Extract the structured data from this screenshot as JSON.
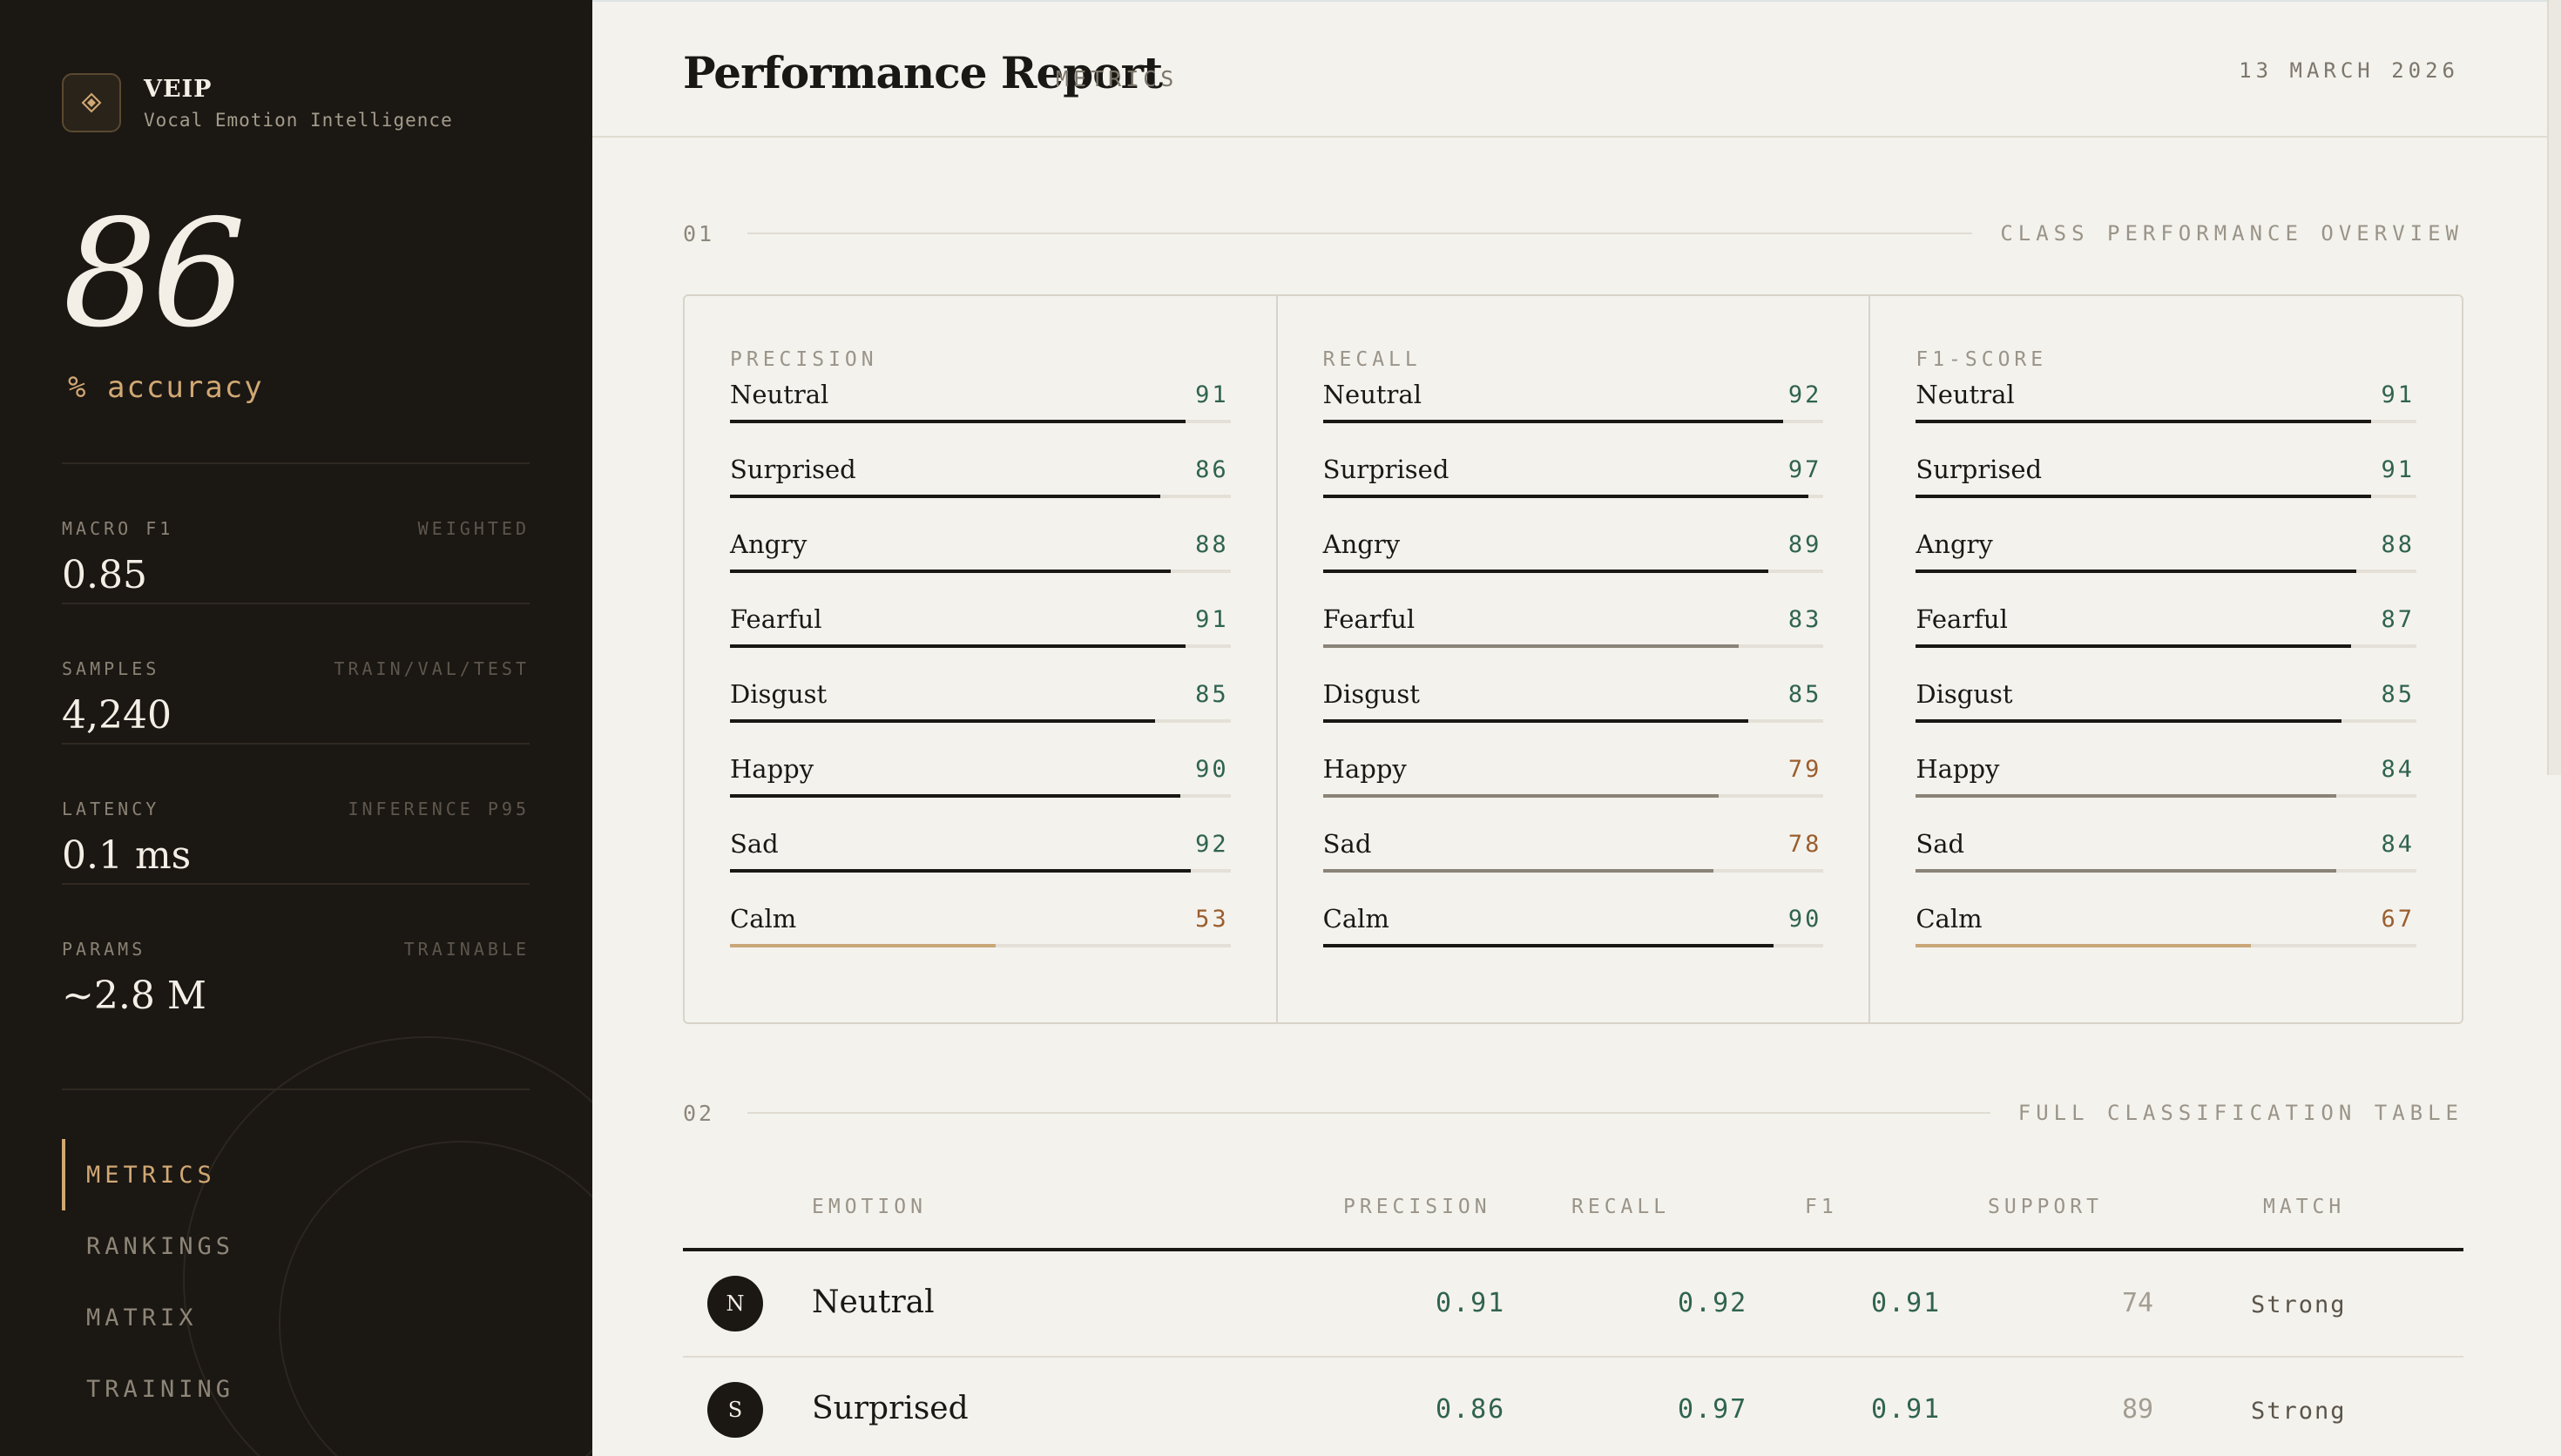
{
  "brand": {
    "name": "VEIP",
    "subtitle": "Vocal Emotion Intelligence",
    "logo_icon": "diamond-icon"
  },
  "accuracy": {
    "value": "86",
    "label": "% accuracy"
  },
  "stats": [
    {
      "label": "MACRO F1",
      "note": "WEIGHTED",
      "value": "0.85"
    },
    {
      "label": "SAMPLES",
      "note": "TRAIN/VAL/TEST",
      "value": "4,240"
    },
    {
      "label": "LATENCY",
      "note": "INFERENCE P95",
      "value": "0.1 ms"
    },
    {
      "label": "PARAMS",
      "note": "TRAINABLE",
      "value": "~2.8 M"
    }
  ],
  "nav": [
    {
      "label": "METRICS",
      "active": true
    },
    {
      "label": "RANKINGS",
      "active": false
    },
    {
      "label": "MATRIX",
      "active": false
    },
    {
      "label": "TRAINING",
      "active": false
    }
  ],
  "header": {
    "title": "Performance Report",
    "tag": "METRICS",
    "date": "13 MARCH 2026"
  },
  "section1": {
    "num": "01",
    "title": "CLASS PERFORMANCE OVERVIEW"
  },
  "section2": {
    "num": "02",
    "title": "FULL CLASSIFICATION TABLE"
  },
  "columns": [
    {
      "title": "PRECISION",
      "rows": [
        {
          "label": "Neutral",
          "value": "91"
        },
        {
          "label": "Surprised",
          "value": "86"
        },
        {
          "label": "Angry",
          "value": "88"
        },
        {
          "label": "Fearful",
          "value": "91"
        },
        {
          "label": "Disgust",
          "value": "85"
        },
        {
          "label": "Happy",
          "value": "90"
        },
        {
          "label": "Sad",
          "value": "92"
        },
        {
          "label": "Calm",
          "value": "53"
        }
      ]
    },
    {
      "title": "RECALL",
      "rows": [
        {
          "label": "Neutral",
          "value": "92"
        },
        {
          "label": "Surprised",
          "value": "97"
        },
        {
          "label": "Angry",
          "value": "89"
        },
        {
          "label": "Fearful",
          "value": "83"
        },
        {
          "label": "Disgust",
          "value": "85"
        },
        {
          "label": "Happy",
          "value": "79"
        },
        {
          "label": "Sad",
          "value": "78"
        },
        {
          "label": "Calm",
          "value": "90"
        }
      ]
    },
    {
      "title": "F1-SCORE",
      "rows": [
        {
          "label": "Neutral",
          "value": "91"
        },
        {
          "label": "Surprised",
          "value": "91"
        },
        {
          "label": "Angry",
          "value": "88"
        },
        {
          "label": "Fearful",
          "value": "87"
        },
        {
          "label": "Disgust",
          "value": "85"
        },
        {
          "label": "Happy",
          "value": "84"
        },
        {
          "label": "Sad",
          "value": "84"
        },
        {
          "label": "Calm",
          "value": "67"
        }
      ]
    }
  ],
  "table": {
    "headers": [
      "EMOTION",
      "PRECISION",
      "RECALL",
      "F1",
      "SUPPORT",
      "MATCH"
    ],
    "rows": [
      {
        "initial": "N",
        "emotion": "Neutral",
        "precision": "0.91",
        "recall": "0.92",
        "f1": "0.91",
        "support": "74",
        "match": "Strong"
      },
      {
        "initial": "S",
        "emotion": "Surprised",
        "precision": "0.86",
        "recall": "0.97",
        "f1": "0.91",
        "support": "89",
        "match": "Strong"
      }
    ]
  },
  "colors": {
    "sidebar_bg": "#1b1713",
    "accent_gold": "#d1a874",
    "value_green": "#2f6350",
    "value_warn": "#9a5e2e",
    "page_bg": "#f4f2ed"
  }
}
